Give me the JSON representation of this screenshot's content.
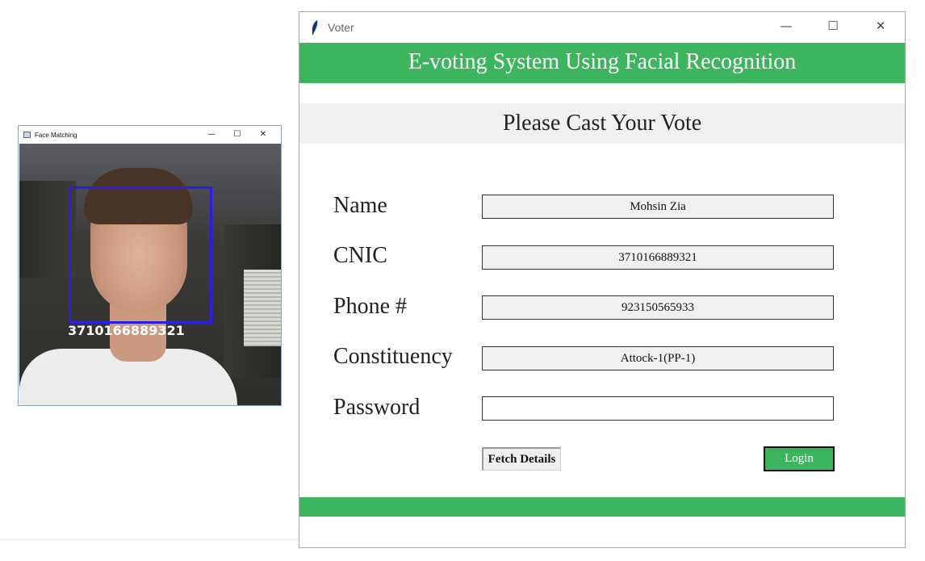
{
  "face_window": {
    "title": "Face Matching",
    "recognized_id": "3710166889321",
    "controls": {
      "minimize": "—",
      "maximize": "☐",
      "close": "✕"
    }
  },
  "voter_window": {
    "title": "Voter",
    "controls": {
      "minimize": "—",
      "maximize": "☐",
      "close": "✕"
    },
    "banner": "E-voting System Using Facial Recognition",
    "subtitle": "Please Cast Your Vote",
    "fields": {
      "name": {
        "label": "Name",
        "value": "Mohsin Zia"
      },
      "cnic": {
        "label": "CNIC",
        "value": "3710166889321"
      },
      "phone": {
        "label": "Phone #",
        "value": "923150565933"
      },
      "constituency": {
        "label": "Constituency",
        "value": "Attock-1(PP-1)"
      },
      "password": {
        "label": "Password",
        "value": ""
      }
    },
    "buttons": {
      "fetch": "Fetch Details",
      "login": "Login"
    }
  },
  "colors": {
    "accent_green": "#3db55e",
    "face_box": "#2a1ee6"
  }
}
